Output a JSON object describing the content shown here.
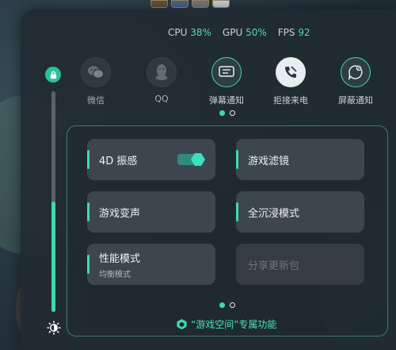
{
  "stats": [
    {
      "label": "CPU",
      "value": "38%"
    },
    {
      "label": "GPU",
      "value": "50%"
    },
    {
      "label": "FPS",
      "value": "92"
    }
  ],
  "apps": [
    {
      "label": "微信",
      "icon": "wechat-icon"
    },
    {
      "label": "QQ",
      "icon": "qq-icon"
    },
    {
      "label": "弹幕通知",
      "icon": "barrage-notification-icon"
    },
    {
      "label": "拒接来电",
      "icon": "reject-call-icon"
    },
    {
      "label": "屏蔽通知",
      "icon": "block-notification-icon"
    }
  ],
  "brightness_level": 0.5,
  "tiles": {
    "vibration": {
      "title": "4D 振感",
      "toggle_on": true
    },
    "filter": {
      "title": "游戏滤镜"
    },
    "voice": {
      "title": "游戏变声"
    },
    "immersive": {
      "title": "全沉浸模式"
    },
    "performance": {
      "title": "性能模式",
      "subtitle": "均衡模式"
    },
    "share": {
      "title": "分享更新包"
    }
  },
  "footer": {
    "label": "“游戏空间”专属功能"
  },
  "colors": {
    "accent": "#3fd8b2",
    "panel": "#202a32",
    "tile": "#3d464e"
  }
}
